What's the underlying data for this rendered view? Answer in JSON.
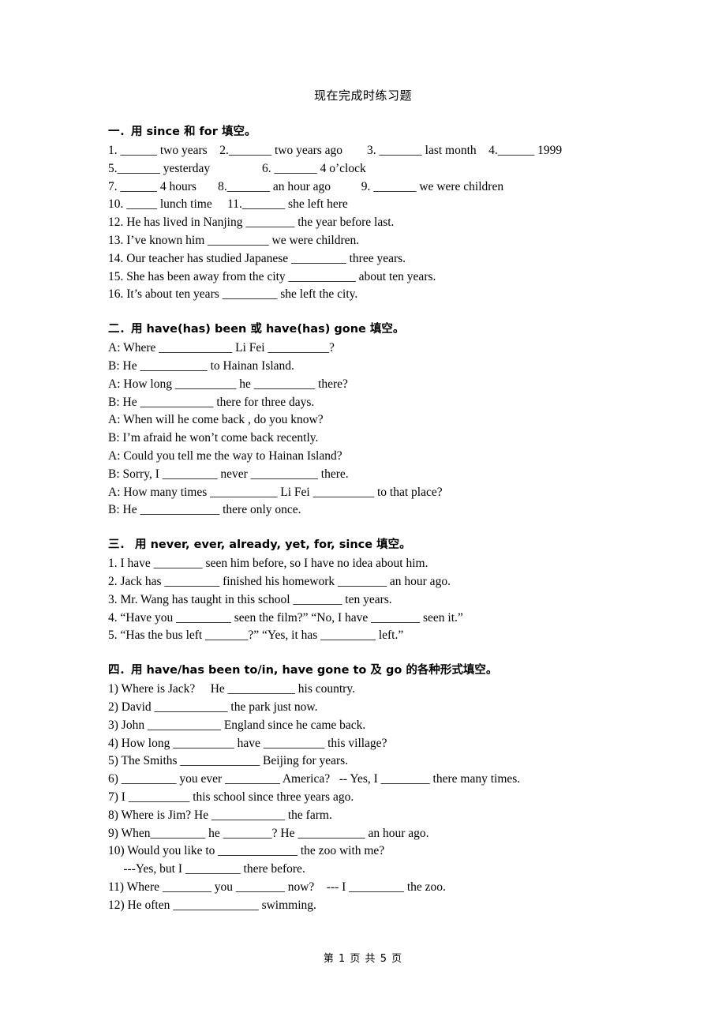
{
  "document": {
    "title": "现在完成时练习题",
    "footer": "第 1 页 共 5 页"
  },
  "sections": [
    {
      "heading_prefix": "一．",
      "heading": "用 since 和 for 填空。",
      "heading_full": "一．用 since 和 for 填空。",
      "lines": [
        "1. ______ two years    2._______ two years ago        3. _______ last month    4.______ 1999",
        "5._______ yesterday                 6. _______ 4 o’clock",
        "7. ______ 4 hours       8._______ an hour ago          9. _______ we were children",
        "10. _____ lunch time     11._______ she left here",
        "12. He has lived in Nanjing ________ the year before last.",
        "13. I’ve known him __________ we were children.",
        "14. Our teacher has studied Japanese _________ three years.",
        "15. She has been away from the city ___________ about ten years.",
        "16. It’s about ten years _________ she left the city."
      ]
    },
    {
      "heading_prefix": "二．",
      "heading": "用 have(has) been 或 have(has) gone 填空。",
      "heading_full": "二．用 have(has) been 或 have(has) gone 填空。",
      "lines": [
        "A: Where ____________ Li Fei __________?",
        "B: He ___________ to Hainan Island.",
        "A: How long __________ he __________ there?",
        "B: He ____________ there for three days.",
        "A: When will he come back , do you know?",
        "B: I’m afraid he won’t come back recently.",
        "A: Could you tell me the way to Hainan Island?",
        "B: Sorry, I _________ never ___________ there.",
        "A: How many times ___________ Li Fei __________ to that place?",
        "B: He _____________ there only once."
      ]
    },
    {
      "heading_prefix": "三．",
      "heading": "用 never, ever, already, yet, for, since 填空。",
      "heading_full": "三．  用 never, ever, already, yet, for, since 填空。",
      "lines": [
        "1. I have ________ seen him before, so I have no idea about him.",
        "2. Jack has _________ finished his homework ________ an hour ago.",
        "3. Mr. Wang has taught in this school ________ ten years.",
        "4. “Have you _________ seen the film?” “No, I have ________ seen it.”",
        "5. “Has the bus left _______?” “Yes, it has _________ left.”"
      ]
    },
    {
      "heading_prefix": "四．",
      "heading": "用 have/has been to/in, have gone to 及 go 的各种形式填空。",
      "heading_full": "四．用 have/has been to/in, have gone to 及 go 的各种形式填空。",
      "lines": [
        "1) Where is Jack?     He ___________ his country.",
        "2) David ____________ the park just now.",
        "3) John ____________ England since he came back.",
        "4) How long __________ have __________ this village?",
        "5) The Smiths _____________ Beijing for years.",
        "6) _________ you ever _________ America?   -- Yes, I ________ there many times.",
        "7) I __________ this school since three years ago.",
        "8) Where is Jim? He ____________ the farm.",
        "9) When_________ he ________? He ___________ an hour ago.",
        "10) Would you like to _____________ the zoo with me?",
        "     ---Yes, but I _________ there before.",
        "11) Where ________ you ________ now?    --- I _________ the zoo.",
        "12) He often ______________ swimming."
      ]
    }
  ]
}
